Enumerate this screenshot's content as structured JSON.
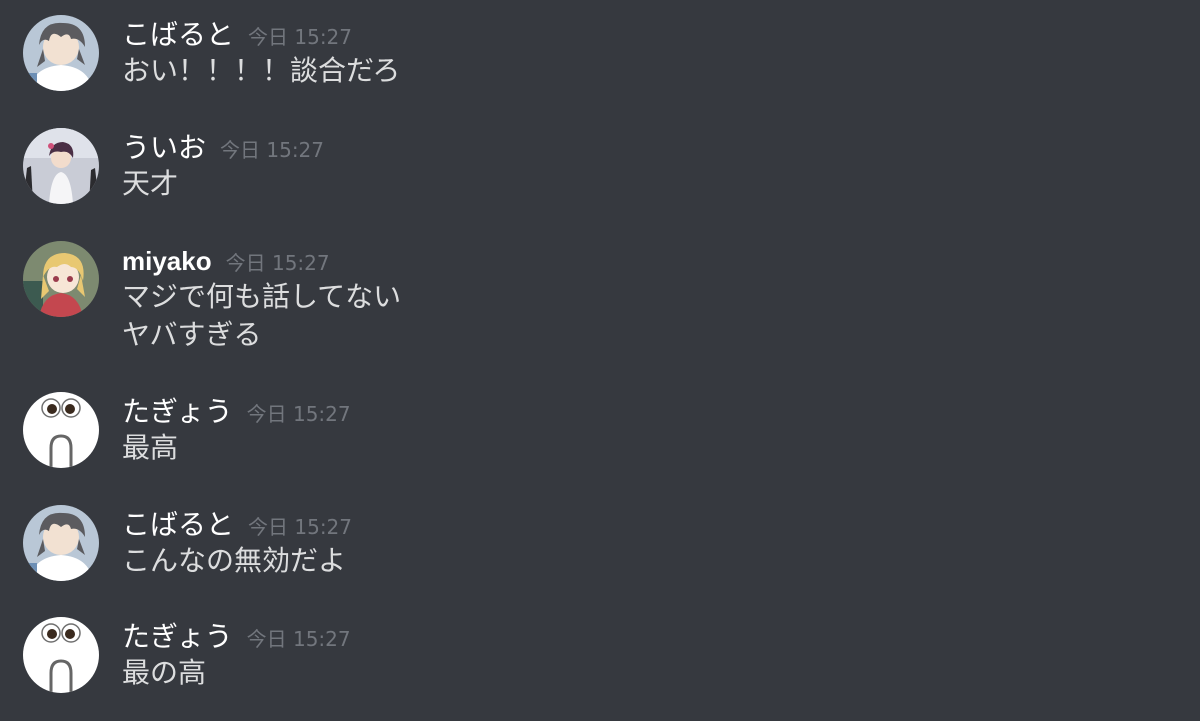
{
  "messages": [
    {
      "author": "こばると",
      "avatar": "kobaruto-avatar",
      "timestamp": "今日 15:27",
      "lines": [
        "おい！！！！談合だろ"
      ]
    },
    {
      "author": "ういお",
      "avatar": "uio-avatar",
      "timestamp": "今日 15:27",
      "lines": [
        "天才"
      ]
    },
    {
      "author": "miyako",
      "avatar": "miyako-avatar",
      "timestamp": "今日 15:27",
      "lines": [
        "マジで何も話してない",
        "ヤバすぎる"
      ]
    },
    {
      "author": "たぎょう",
      "avatar": "tagyou-avatar",
      "timestamp": "今日 15:27",
      "lines": [
        "最高"
      ]
    },
    {
      "author": "こばると",
      "avatar": "kobaruto-avatar",
      "timestamp": "今日 15:27",
      "lines": [
        "こんなの無効だよ"
      ]
    },
    {
      "author": "たぎょう",
      "avatar": "tagyou-avatar",
      "timestamp": "今日 15:27",
      "lines": [
        "最の高"
      ]
    }
  ],
  "colors": {
    "background": "#36393f",
    "author": "#ffffff",
    "timestamp": "#72767d",
    "text": "#dcddde"
  }
}
